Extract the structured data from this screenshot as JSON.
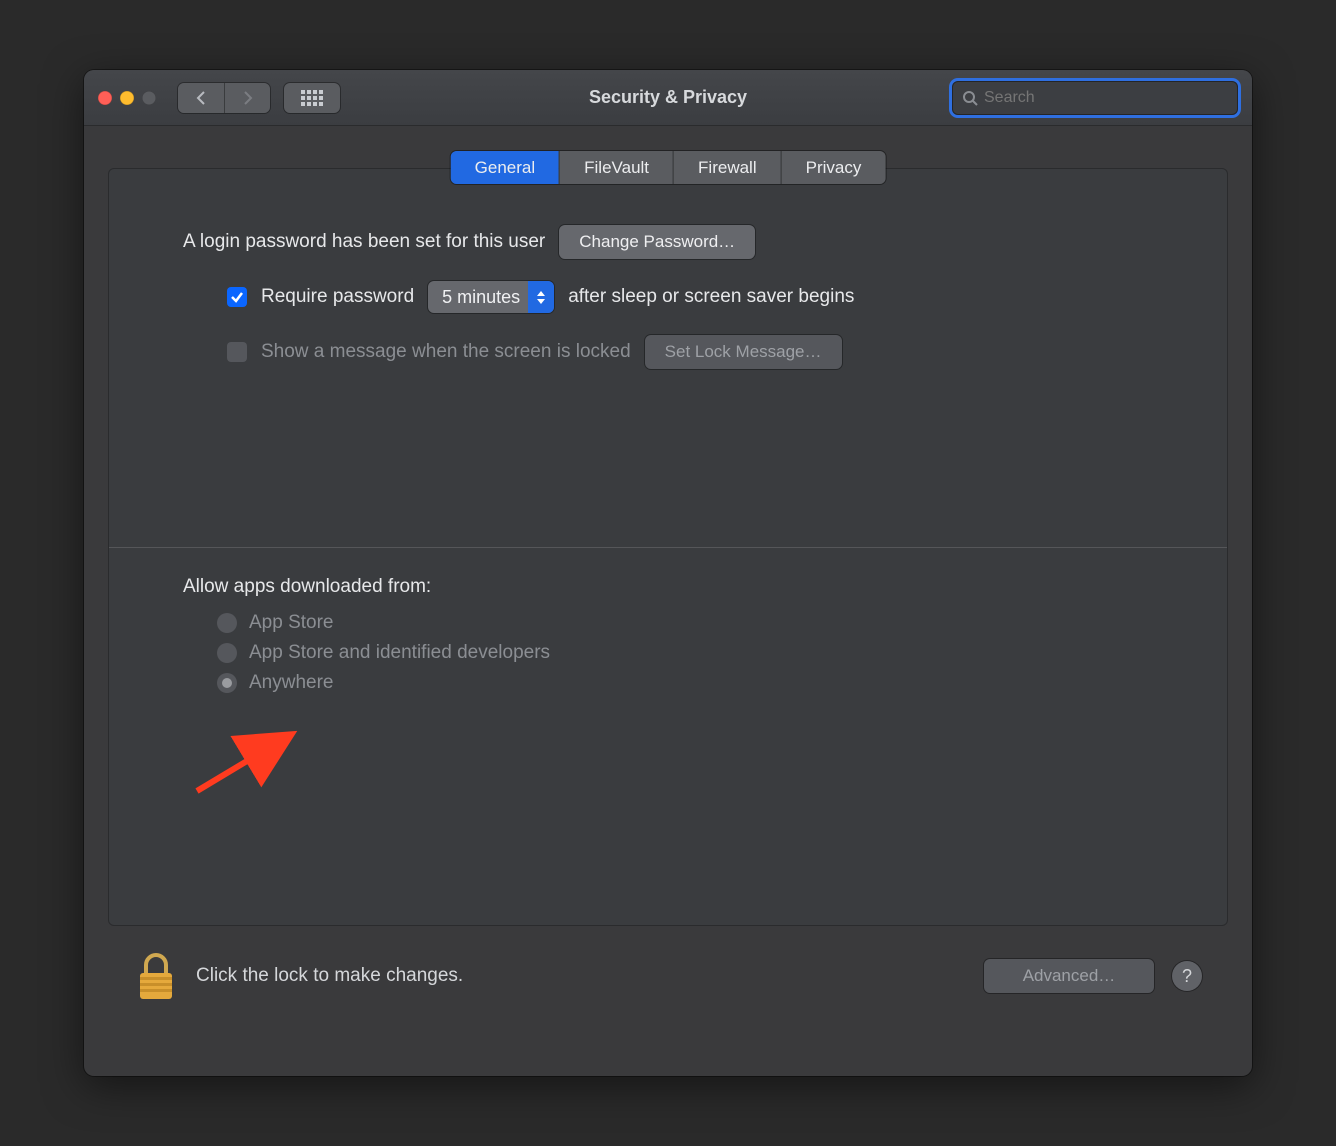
{
  "window": {
    "title": "Security & Privacy"
  },
  "toolbar": {
    "search_placeholder": "Search"
  },
  "tabs": [
    "General",
    "FileVault",
    "Firewall",
    "Privacy"
  ],
  "active_tab_index": 0,
  "general": {
    "login_password_note": "A login password has been set for this user",
    "change_password_btn": "Change Password…",
    "require_password": {
      "checked": true,
      "label_prefix": "Require password",
      "delay_value": "5 minutes",
      "label_suffix": "after sleep or screen saver begins"
    },
    "lock_message": {
      "checked": false,
      "label": "Show a message when the screen is locked",
      "button": "Set Lock Message…"
    },
    "allow_apps": {
      "title": "Allow apps downloaded from:",
      "options": [
        "App Store",
        "App Store and identified developers",
        "Anywhere"
      ],
      "selected_index": 2
    }
  },
  "footer": {
    "lock_hint": "Click the lock to make changes.",
    "advanced_btn": "Advanced…",
    "help_label": "?"
  }
}
